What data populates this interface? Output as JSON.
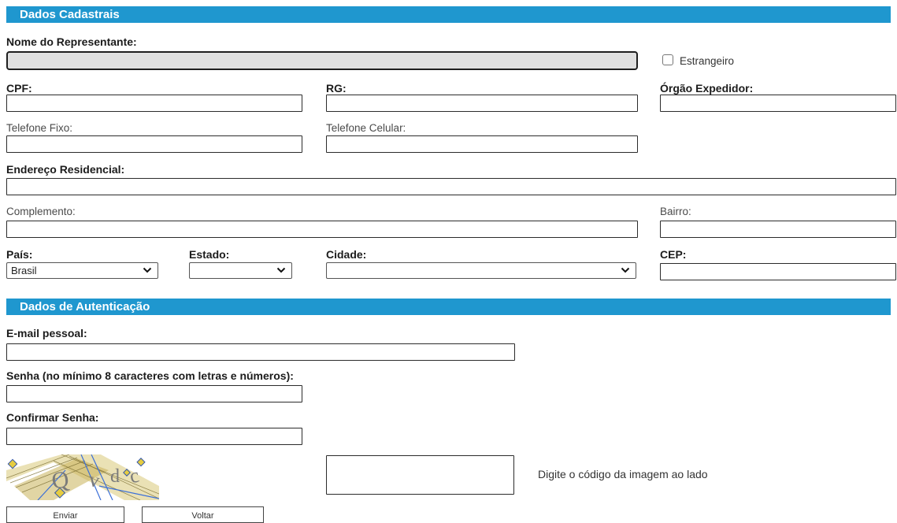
{
  "sections": {
    "cadastrais": "Dados Cadastrais",
    "autenticacao": "Dados de Autenticação"
  },
  "fields": {
    "nome": {
      "label": "Nome do Representante:",
      "value": ""
    },
    "estrangeiro": {
      "label": "Estrangeiro",
      "checked": false
    },
    "cpf": {
      "label": "CPF:",
      "value": ""
    },
    "rg": {
      "label": "RG:",
      "value": ""
    },
    "orgao": {
      "label": "Órgão Expedidor:",
      "value": ""
    },
    "telefone_fixo": {
      "label": "Telefone Fixo:",
      "value": ""
    },
    "telefone_celular": {
      "label": "Telefone Celular:",
      "value": ""
    },
    "endereco": {
      "label": "Endereço Residencial:",
      "value": ""
    },
    "complemento": {
      "label": "Complemento:",
      "value": ""
    },
    "bairro": {
      "label": "Bairro:",
      "value": ""
    },
    "pais": {
      "label": "País:",
      "value": "Brasil"
    },
    "estado": {
      "label": "Estado:",
      "value": ""
    },
    "cidade": {
      "label": "Cidade:",
      "value": ""
    },
    "cep": {
      "label": "CEP:",
      "value": ""
    },
    "email": {
      "label": "E-mail pessoal:",
      "value": ""
    },
    "senha": {
      "label": "Senha (no mínimo 8 caracteres com letras e números):",
      "value": ""
    },
    "confirmar": {
      "label": "Confirmar Senha:",
      "value": ""
    }
  },
  "captcha": {
    "image_text": "Qvdc",
    "input_value": "",
    "hint": "Digite o código da imagem ao lado"
  },
  "buttons": {
    "enviar": "Enviar",
    "voltar": "Voltar"
  },
  "colors": {
    "section_bar": "#1f97cf",
    "disabled_field": "#e0e0e0"
  },
  "icons": {
    "select_arrow": "chevron-down-icon"
  }
}
